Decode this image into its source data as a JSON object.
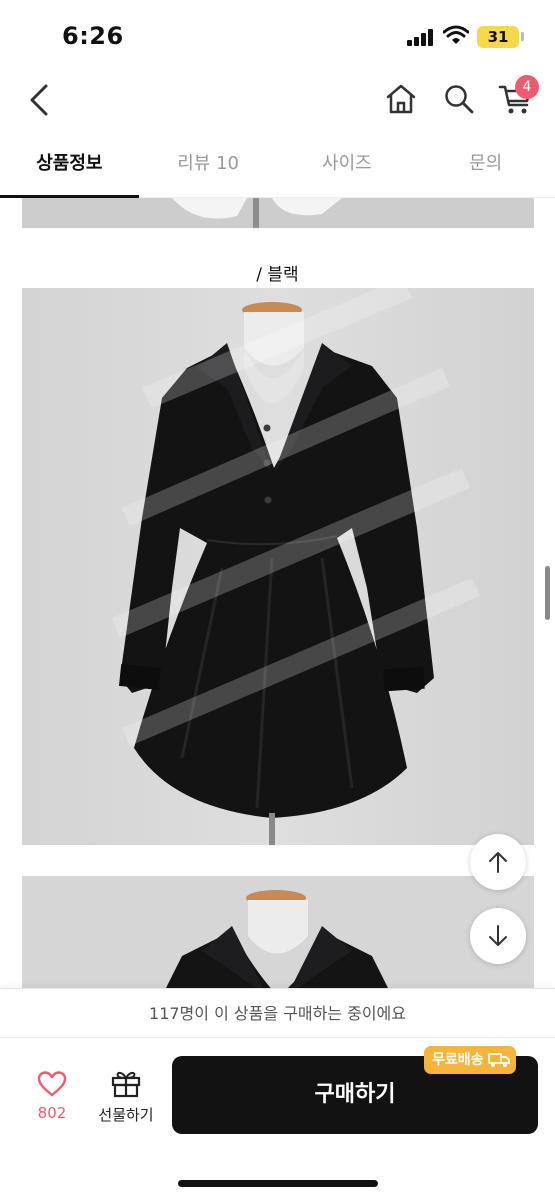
{
  "status_bar": {
    "time": "6:26",
    "battery": "31",
    "battery_color": "#f6d84a"
  },
  "nav": {
    "back_icon": "chevron-left-icon",
    "home_icon": "home-icon",
    "search_icon": "search-icon",
    "cart_icon": "cart-icon",
    "cart_count": "4"
  },
  "tabs": [
    {
      "label": "상품정보",
      "active": true
    },
    {
      "label": "리뷰 10",
      "active": false
    },
    {
      "label": "사이즈",
      "active": false
    },
    {
      "label": "문의",
      "active": false
    }
  ],
  "content": {
    "color_caption": "/ 블랙"
  },
  "purchase_notice": "117명이 이 상품을 구매하는 중이에요",
  "bottom_bar": {
    "like_count": "802",
    "gift_label": "선물하기",
    "buy_label": "구매하기",
    "free_shipping_badge": "무료배송"
  },
  "colors": {
    "accent_pink": "#f05a70",
    "buy_button": "#121212",
    "shipping_badge": "#f7b43a"
  }
}
